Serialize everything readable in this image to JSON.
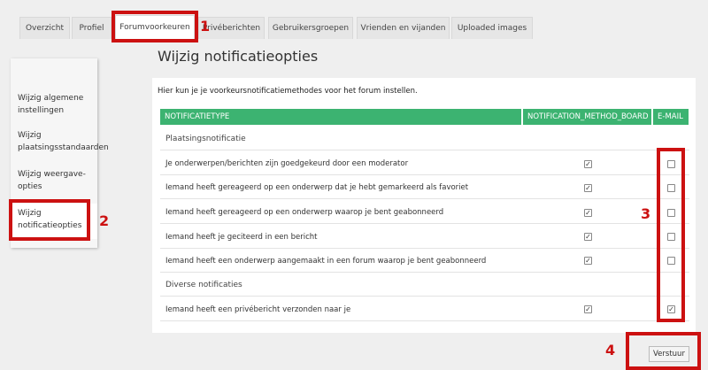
{
  "tabs": [
    "Overzicht",
    "Profiel",
    "Forumvoorkeuren",
    "Privéberichten",
    "Gebruikersgroepen",
    "Vrienden en vijanden",
    "Uploaded images"
  ],
  "sidebar": {
    "items": [
      {
        "label": "Wijzig algemene instellingen"
      },
      {
        "label": "Wijzig plaatsingsstandaarden"
      },
      {
        "label": "Wijzig weergave-opties"
      },
      {
        "label": "Wijzig notificatieopties"
      }
    ]
  },
  "main": {
    "title": "Wijzig notificatieopties",
    "intro": "Hier kun je je voorkeursnotificatiemethodes voor het forum instellen.",
    "columns": [
      "NOTIFICATIETYPE",
      "NOTIFICATION_METHOD_BOARD",
      "E-MAIL"
    ],
    "groups": [
      {
        "name": "Plaatsingsnotificatie",
        "rows": [
          {
            "label": "Je onderwerpen/berichten zijn goedgekeurd door een moderator",
            "board": true,
            "email": false
          },
          {
            "label": "Iemand heeft gereageerd op een onderwerp dat je hebt gemarkeerd als favoriet",
            "board": true,
            "email": false
          },
          {
            "label": "Iemand heeft gereageerd op een onderwerp waarop je bent geabonneerd",
            "board": true,
            "email": false
          },
          {
            "label": "Iemand heeft je geciteerd in een bericht",
            "board": true,
            "email": false
          },
          {
            "label": "Iemand heeft een onderwerp aangemaakt in een forum waarop je bent geabonneerd",
            "board": true,
            "email": false
          }
        ]
      },
      {
        "name": "Diverse notificaties",
        "rows": [
          {
            "label": "Iemand heeft een privébericht verzonden naar je",
            "board": true,
            "email": true
          }
        ]
      }
    ],
    "submit_label": "Verstuur"
  },
  "annotations": [
    "1",
    "2",
    "3",
    "4"
  ],
  "colors": {
    "header_green": "#3cb371",
    "annotation_red": "#cc1111"
  }
}
